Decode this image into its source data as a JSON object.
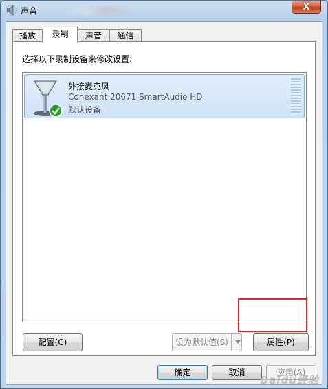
{
  "window": {
    "title": "声音",
    "close_symbol": "X",
    "accent_close": "#c2401f"
  },
  "tabs": [
    {
      "label": "播放",
      "active": false
    },
    {
      "label": "录制",
      "active": true
    },
    {
      "label": "声音",
      "active": false
    },
    {
      "label": "通信",
      "active": false
    }
  ],
  "panel": {
    "instruction": "选择以下录制设备来修改设置:"
  },
  "devices": [
    {
      "name": "外接麦克风",
      "driver": "Conexant 20671 SmartAudio HD",
      "status": "默认设备",
      "icon": "microphone-icon",
      "default_badge": "green-check-icon"
    }
  ],
  "panel_buttons": {
    "configure": "配置(C)",
    "set_default": "设为默认值(S)",
    "properties": "属性(P)"
  },
  "dialog_buttons": {
    "ok": "确定",
    "cancel": "取消",
    "apply": "应用(A)"
  },
  "watermark": "Baidu经验",
  "colors": {
    "selection": "#cfe2f8",
    "highlight_box": "#e0262d"
  }
}
